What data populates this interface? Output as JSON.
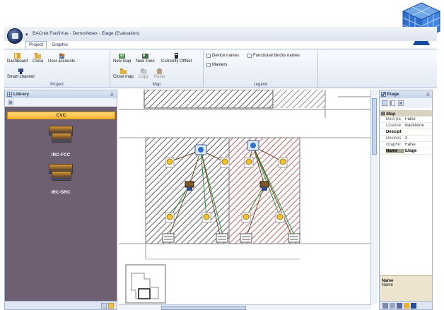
{
  "app": {
    "title": "BACnet FaciliVue - DemoVebex - Etage (Evaluation)"
  },
  "ribbon_tabs": [
    "Project",
    "Graphic"
  ],
  "ribbon": {
    "project_group": {
      "label": "Project",
      "buttons": [
        "Dashboard",
        "Close",
        "User accounts",
        "Smart channel"
      ]
    },
    "map_group": {
      "label": "Map",
      "buttons": [
        "New map",
        "New zone",
        "Currently OffNet",
        "Close map",
        "Copy",
        "Paste"
      ]
    },
    "legend_group": {
      "label": "Legend",
      "checkboxes": [
        "Device names",
        "Masters",
        "Functional blocks names"
      ]
    }
  },
  "library": {
    "title": "Library",
    "category": "CVC",
    "items": [
      "IRC-FCC",
      "IRC-SRC"
    ]
  },
  "properties": {
    "title": "Etage",
    "category": "Map",
    "rows": [
      {
        "key": "Boot pa",
        "value": "False",
        "selected": false
      },
      {
        "key": "Channe",
        "value": "Backbone",
        "selected": false
      },
      {
        "key": "Descipt",
        "value": "",
        "selected": false
      },
      {
        "key": "Devices",
        "value": "3",
        "selected": false
      },
      {
        "key": "Graphic",
        "value": "False",
        "selected": false
      },
      {
        "key": "Name",
        "value": "Etage",
        "selected": true
      }
    ],
    "description_title": "Name",
    "description_text": "Name"
  },
  "colors": {
    "accent": "#f4b42f",
    "library_bg": "#6e5f72",
    "ribbon_border": "#9fb3d3",
    "zone_left_hatch": "#3a3a3a",
    "zone_right_hatch": "#b03a3a",
    "wire_green": "#2e8b3a",
    "wire_brown": "#6b4a2a"
  },
  "icons": {
    "logo": "cube-logo-icon",
    "master_device": "master-device-icon",
    "controller": "controller-icon",
    "lamp": "lightbulb-icon",
    "fan_coil": "fan-coil-icon"
  }
}
